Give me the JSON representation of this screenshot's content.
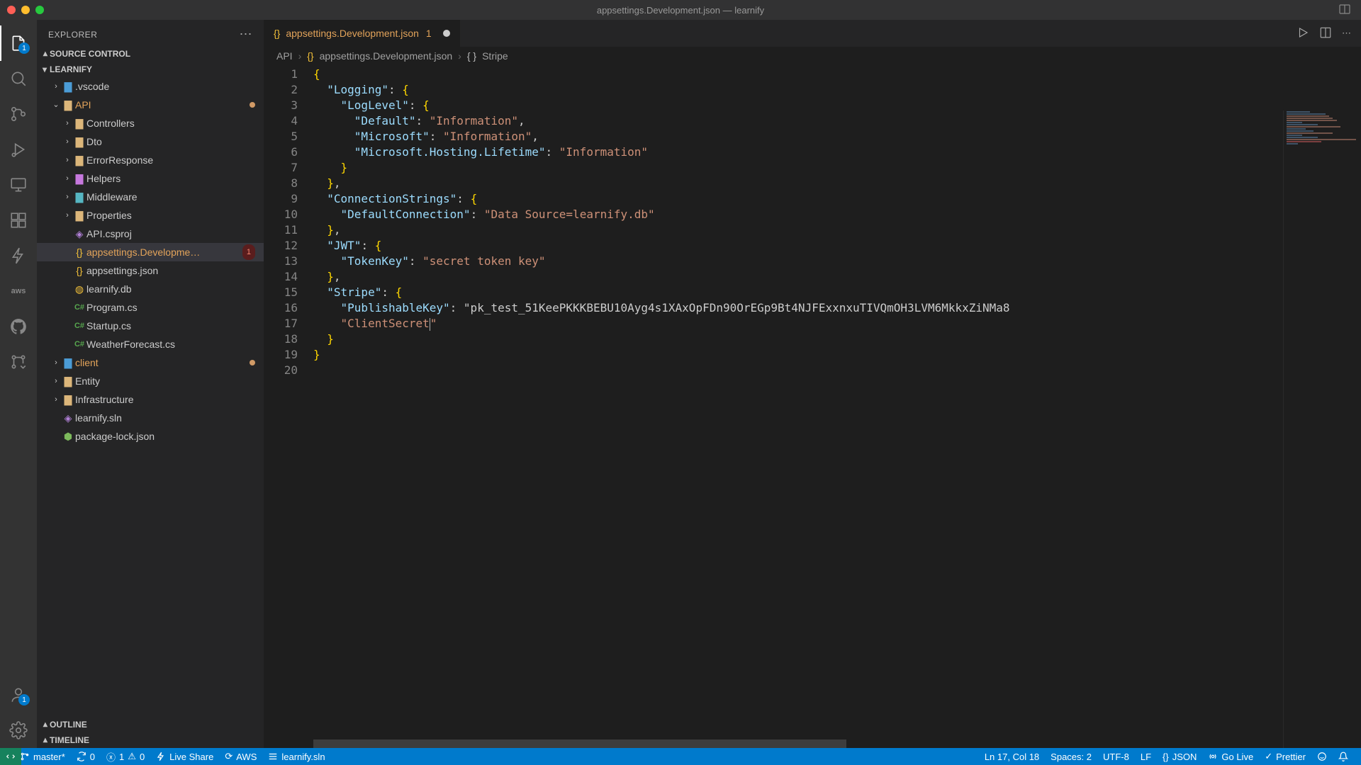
{
  "window": {
    "title": "appsettings.Development.json — learnify"
  },
  "sidebar": {
    "header": "EXPLORER",
    "sections": {
      "source_control": "SOURCE CONTROL",
      "workspace": "LEARNIFY",
      "outline": "OUTLINE",
      "timeline": "TIMELINE"
    },
    "tree": {
      "vscode": ".vscode",
      "api": "API",
      "controllers": "Controllers",
      "dto": "Dto",
      "error": "ErrorResponse",
      "helpers": "Helpers",
      "middleware": "Middleware",
      "properties": "Properties",
      "csproj": "API.csproj",
      "appdev": "appsettings.Developme…",
      "appdev_badge": "1",
      "appjson": "appsettings.json",
      "db": "learnify.db",
      "program": "Program.cs",
      "startup": "Startup.cs",
      "weather": "WeatherForecast.cs",
      "client": "client",
      "entity": "Entity",
      "infra": "Infrastructure",
      "sln": "learnify.sln",
      "pkg": "package-lock.json"
    }
  },
  "activity": {
    "explorer_badge": "1",
    "account_badge": "1"
  },
  "tab": {
    "name": "appsettings.Development.json",
    "badge": "1"
  },
  "breadcrumb": {
    "p1": "API",
    "p2": "appsettings.Development.json",
    "p3": "Stripe"
  },
  "code": {
    "lines": [
      "{",
      "  \"Logging\": {",
      "    \"LogLevel\": {",
      "      \"Default\": \"Information\",",
      "      \"Microsoft\": \"Information\",",
      "      \"Microsoft.Hosting.Lifetime\": \"Information\"",
      "    }",
      "  },",
      "  \"ConnectionStrings\": {",
      "    \"DefaultConnection\": \"Data Source=learnify.db\"",
      "  },",
      "  \"JWT\": {",
      "    \"TokenKey\": \"secret token key\"",
      "  },",
      "  \"Stripe\": {",
      "    \"PublishableKey\": \"pk_test_51KeePKKKBEBU10Ayg4s1XAxOpFDn90OrEGp9Bt4NJFExxnxuTIVQmOH3LVM6MkkxZiNMa8",
      "    \"ClientSecret|\"",
      "  }",
      "}",
      ""
    ],
    "start_line": 1
  },
  "status": {
    "branch": "master*",
    "sync": "0",
    "errors": "1",
    "warnings": "0",
    "live_share": "Live Share",
    "aws": "AWS",
    "sln": "learnify.sln",
    "pos": "Ln 17, Col 18",
    "spaces": "Spaces: 2",
    "encoding": "UTF-8",
    "eol": "LF",
    "lang": "JSON",
    "go_live": "Go Live",
    "prettier": "Prettier"
  }
}
